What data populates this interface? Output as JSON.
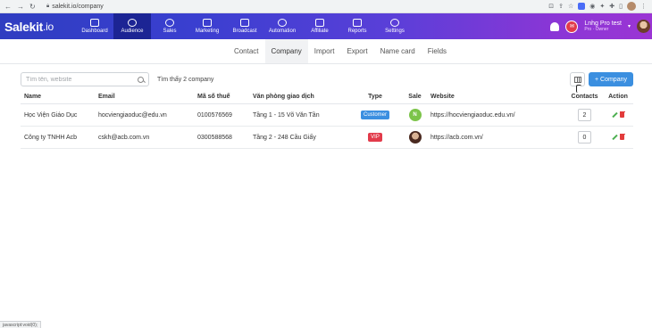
{
  "browser": {
    "url": "salekit.io/company"
  },
  "app": {
    "logo_text": "Salekit",
    "logo_suffix": ".io",
    "menu": [
      {
        "label": "Dashboard",
        "icon": "home-icon"
      },
      {
        "label": "Audience",
        "icon": "users-icon",
        "active": true
      },
      {
        "label": "Sales",
        "icon": "dollar-icon"
      },
      {
        "label": "Marketing",
        "icon": "chart-line-icon"
      },
      {
        "label": "Broadcast",
        "icon": "megaphone-icon"
      },
      {
        "label": "Automation",
        "icon": "sync-icon"
      },
      {
        "label": "Affiliate",
        "icon": "network-icon"
      },
      {
        "label": "Reports",
        "icon": "bar-chart-icon"
      },
      {
        "label": "Settings",
        "icon": "gear-icon"
      }
    ],
    "user": {
      "name": "Lnhg Pro test",
      "role": "Pro · Owner"
    },
    "colors": {
      "bar_start": "#2f3dc1",
      "bar_end": "#9b35d4",
      "active_menu": "#1c2494",
      "primary_button": "#3b8fe0"
    }
  },
  "subtabs": [
    {
      "label": "Contact"
    },
    {
      "label": "Company",
      "active": true
    },
    {
      "label": "Import"
    },
    {
      "label": "Export"
    },
    {
      "label": "Name card"
    },
    {
      "label": "Fields"
    }
  ],
  "toolbar": {
    "search_placeholder": "Tìm tên, website",
    "found_text": "Tìm thấy 2 company",
    "add_label": "+ Company"
  },
  "table": {
    "headers": {
      "name": "Name",
      "email": "Email",
      "tax": "Mã số thuế",
      "office": "Văn phòng giao dịch",
      "type": "Type",
      "sale": "Sale",
      "website": "Website",
      "contacts": "Contacts",
      "action": "Action"
    },
    "rows": [
      {
        "name": "Học Viện Giáo Dục",
        "email": "hocviengiaoduc@edu.vn",
        "tax": "0100576569",
        "office": "Tầng 1 - 15 Võ Văn Tần",
        "type": "Customer",
        "type_color": "#3b8fe0",
        "sale_initial": "N",
        "sale_color": "#7cc44a",
        "website": "https://hocviengiaoduc.edu.vn/",
        "contacts": "2"
      },
      {
        "name": "Công ty TNHH Acb",
        "email": "cskh@acb.com.vn",
        "tax": "0300588568",
        "office": "Tầng 2 - 248 Cầu Giấy",
        "type": "VIP",
        "type_color": "#e23b4b",
        "sale_initial": "",
        "sale_color": "",
        "website": "https://acb.com.vn/",
        "contacts": "0"
      }
    ]
  },
  "statusbar": {
    "text": "javascript:void(0);"
  }
}
